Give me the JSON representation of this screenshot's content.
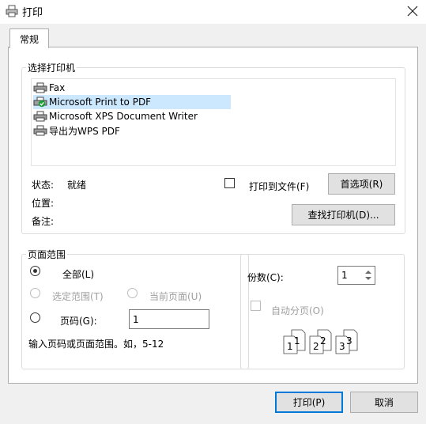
{
  "window": {
    "title": "打印"
  },
  "tabs": [
    {
      "label": "常规"
    }
  ],
  "printer_section": {
    "legend": "选择打印机",
    "printers": [
      {
        "name": "Fax",
        "selected": false
      },
      {
        "name": "Microsoft Print to PDF",
        "selected": true
      },
      {
        "name": "Microsoft XPS Document Writer",
        "selected": false
      },
      {
        "name": "导出为WPS PDF",
        "selected": false
      }
    ],
    "status_label": "状态:",
    "status_value": "就绪",
    "location_label": "位置:",
    "comment_label": "备注:",
    "print_to_file_label": "打印到文件(F)",
    "preferences_button": "首选项(R)",
    "find_printer_button": "查找打印机(D)..."
  },
  "range_section": {
    "legend": "页面范围",
    "all_label": "全部(L)",
    "selection_label": "选定范围(T)",
    "current_page_label": "当前页面(U)",
    "pages_label": "页码(G):",
    "pages_value": "1",
    "hint": "输入页码或页面范围。如，5-12"
  },
  "copies_section": {
    "copies_label": "份数(C):",
    "copies_value": "1",
    "collate_label": "自动分页(O)",
    "collate_pages": [
      "1",
      "1",
      "2",
      "2",
      "3",
      "3"
    ]
  },
  "footer": {
    "print_button": "打印(P)",
    "cancel_button": "取消"
  }
}
